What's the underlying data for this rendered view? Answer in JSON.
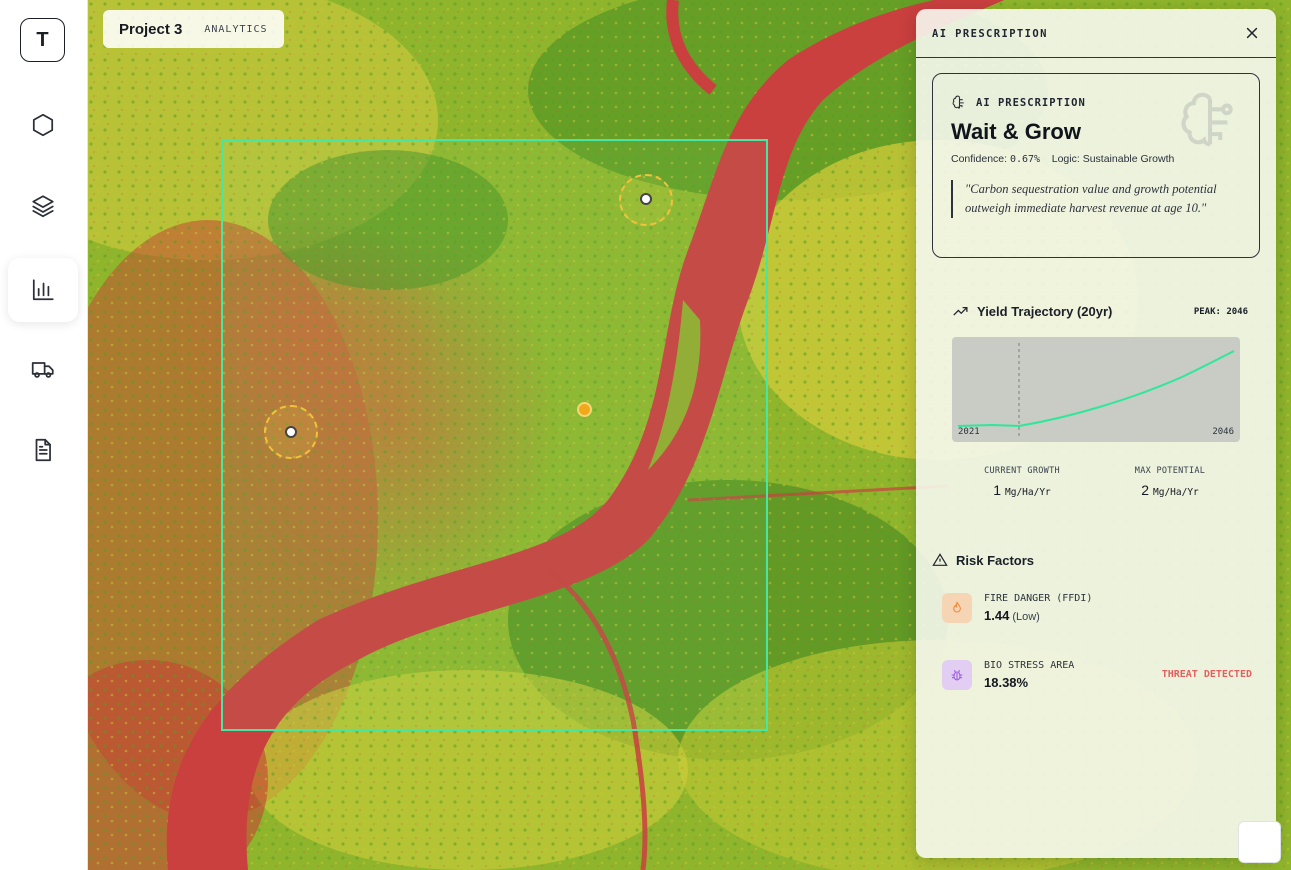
{
  "app": {
    "logo_letter": "T"
  },
  "rail": {
    "items": [
      {
        "id": "hexagon",
        "icon": "hexagon-icon",
        "active": false
      },
      {
        "id": "layers",
        "icon": "layers-icon",
        "active": false
      },
      {
        "id": "analytics",
        "icon": "bar-chart-icon",
        "active": true
      },
      {
        "id": "truck",
        "icon": "truck-icon",
        "active": false
      },
      {
        "id": "report",
        "icon": "document-icon",
        "active": false
      }
    ]
  },
  "map": {
    "project_name": "Project 3",
    "project_tag": "ANALYTICS"
  },
  "panel": {
    "title": "AI PRESCRIPTION",
    "close_icon": "close-icon",
    "prescription": {
      "label": "AI PRESCRIPTION",
      "title": "Wait & Grow",
      "confidence_label": "Confidence:",
      "confidence_value": "0.67%",
      "logic_label": "Logic:",
      "logic_value": "Sustainable Growth",
      "quote": "\"Carbon sequestration value and growth potential outweigh immediate harvest revenue at age 10.\""
    },
    "yield": {
      "title": "Yield Trajectory (20yr)",
      "peak": "PEAK: 2046",
      "start_year": "2021",
      "end_year": "2046",
      "current_growth_label": "CURRENT GROWTH",
      "current_growth_value": "1",
      "current_growth_unit": "Mg/Ha/Yr",
      "max_potential_label": "MAX POTENTIAL",
      "max_potential_value": "2",
      "max_potential_unit": "Mg/Ha/Yr",
      "line_color": "#2fe79a"
    },
    "risk": {
      "title": "Risk Factors",
      "items": [
        {
          "name": "FIRE DANGER (FFDI)",
          "value": "1.44",
          "sub": "(Low)",
          "status": "",
          "icon": "flame-icon",
          "color": "#f08a3c"
        },
        {
          "name": "BIO STRESS AREA",
          "value": "18.38%",
          "sub": "",
          "status": "THREAT DETECTED",
          "icon": "bug-icon",
          "color": "#9b5bd6"
        }
      ]
    }
  },
  "colors": {
    "selection": "#47e6a3",
    "river": "#c9403f",
    "threat": "#e36060"
  }
}
